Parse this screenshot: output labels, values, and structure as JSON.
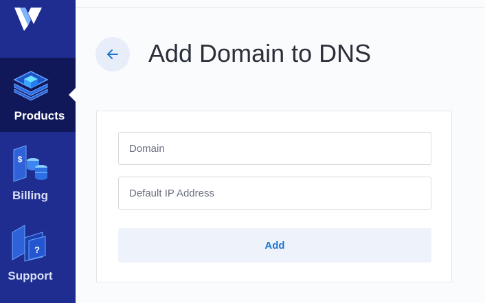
{
  "sidebar": {
    "items": [
      {
        "label": "Products",
        "icon": "products-icon",
        "active": true
      },
      {
        "label": "Billing",
        "icon": "billing-icon",
        "active": false
      },
      {
        "label": "Support",
        "icon": "support-icon",
        "active": false
      }
    ]
  },
  "header": {
    "title": "Add Domain to DNS",
    "back_icon": "arrow-left-icon"
  },
  "form": {
    "domain_placeholder": "Domain",
    "ip_placeholder": "Default IP Address",
    "submit_label": "Add"
  },
  "colors": {
    "sidebar": "#1e2d8f",
    "sidebar_active": "#11185a",
    "accent": "#1f76d2"
  }
}
